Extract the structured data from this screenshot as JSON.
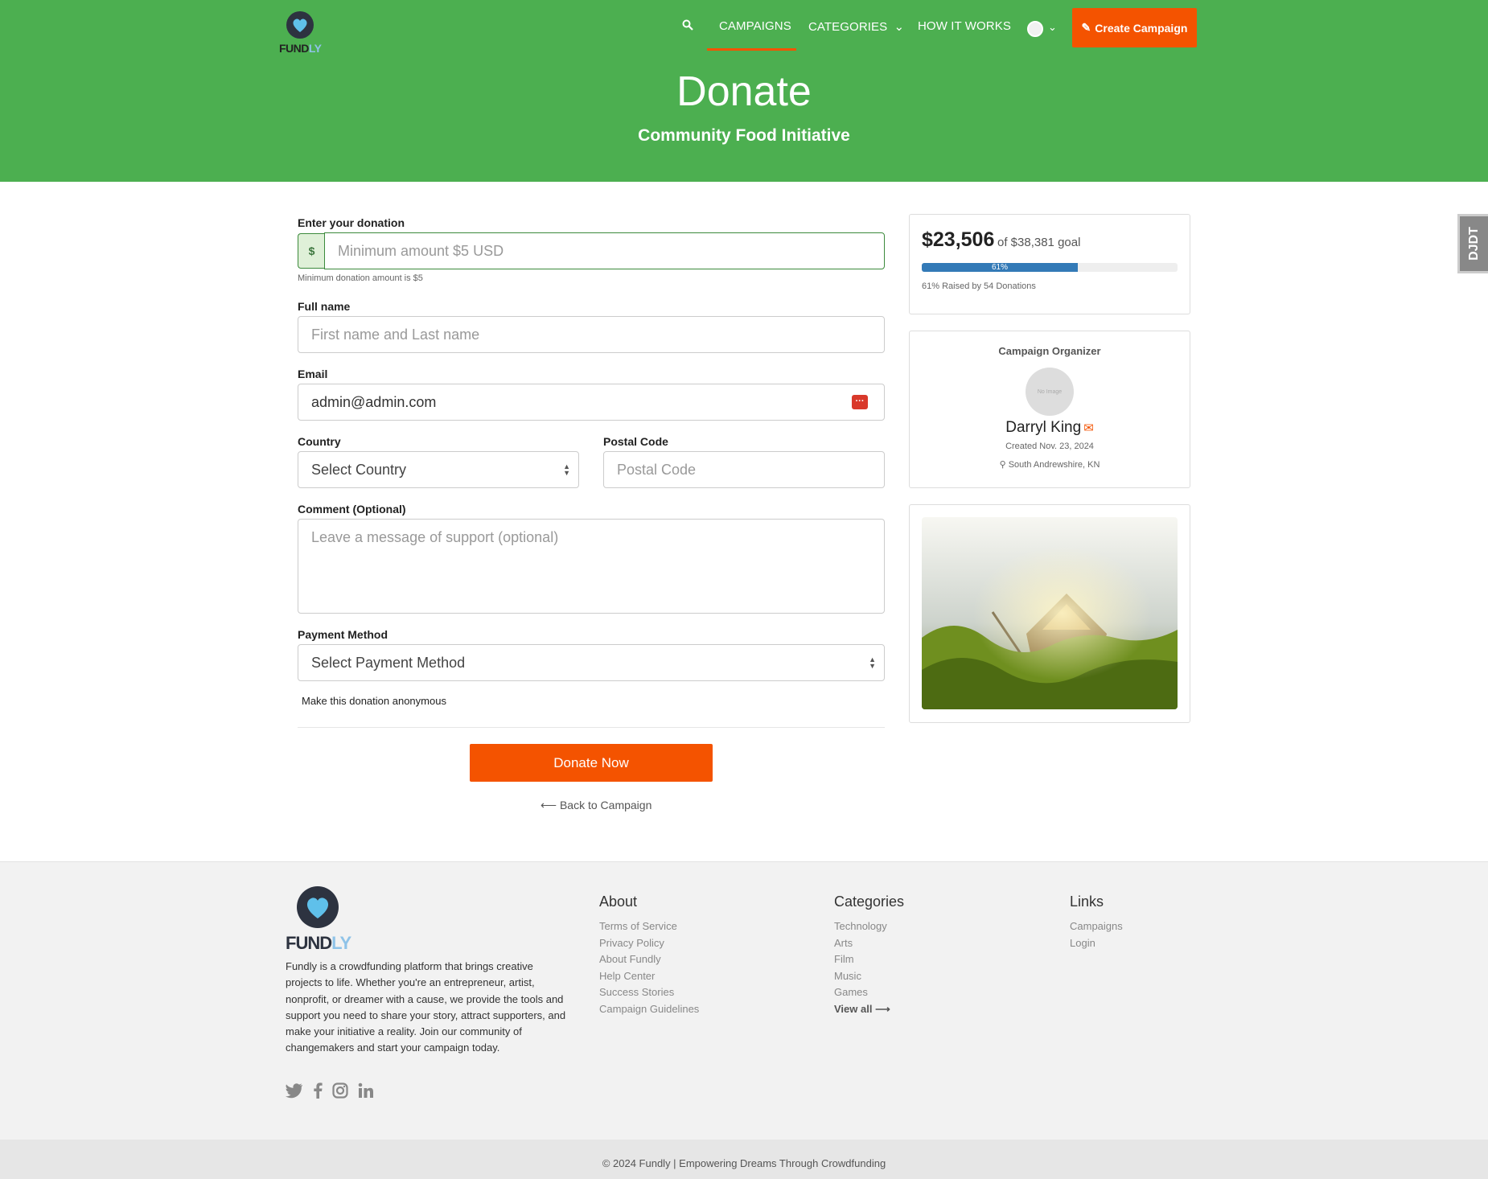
{
  "header": {
    "logo_word": "FUND",
    "logo_word_accent": "LY",
    "nav": {
      "search_icon": "search-icon",
      "campaigns": "CAMPAIGNS",
      "categories": "CATEGORIES",
      "how_it_works": "HOW IT WORKS",
      "create_campaign": "Create Campaign"
    },
    "title": "Donate",
    "subtitle": "Community Food Initiative",
    "accent_color": "#4caf50",
    "cta_color": "#f45300"
  },
  "form": {
    "donation": {
      "label": "Enter your donation",
      "currency": "$",
      "placeholder": "Minimum amount $5 USD",
      "hint": "Minimum donation amount is $5"
    },
    "full_name": {
      "label": "Full name",
      "placeholder": "First name and Last name"
    },
    "email": {
      "label": "Email",
      "value": "admin@admin.com"
    },
    "country": {
      "label": "Country",
      "selected": "Select Country"
    },
    "postal": {
      "label": "Postal Code",
      "placeholder": "Postal Code"
    },
    "comment": {
      "label": "Comment (Optional)",
      "placeholder": "Leave a message of support (optional)"
    },
    "payment": {
      "label": "Payment Method",
      "selected": "Select Payment Method"
    },
    "anonymous_label": "Make this donation anonymous",
    "submit_label": "Donate Now",
    "back_label": "Back to Campaign"
  },
  "campaign": {
    "raised": "$23,506",
    "goal_text": "of $38,381 goal",
    "percent": 61,
    "percent_label": "61%",
    "stats": "61% Raised by 54 Donations"
  },
  "organizer": {
    "heading": "Campaign Organizer",
    "avatar_text": "No Image",
    "name": "Darryl King",
    "created": "Created Nov. 23, 2024",
    "location": "South Andrewshire, KN"
  },
  "side_tab": "DJDT",
  "footer": {
    "logo_word": "FUND",
    "logo_word_accent": "LY",
    "description": "Fundly is a crowdfunding platform that brings creative projects to life. Whether you're an entrepreneur, artist, nonprofit, or dreamer with a cause, we provide the tools and support you need to share your story, attract supporters, and make your initiative a reality. Join our community of changemakers and start your campaign today.",
    "about": {
      "heading": "About",
      "items": [
        "Terms of Service",
        "Privacy Policy",
        "About Fundly",
        "Help Center",
        "Success Stories",
        "Campaign Guidelines"
      ]
    },
    "categories": {
      "heading": "Categories",
      "items": [
        "Technology",
        "Arts",
        "Film",
        "Music",
        "Games"
      ],
      "view_all": "View all"
    },
    "links": {
      "heading": "Links",
      "items": [
        "Campaigns",
        "Login"
      ]
    },
    "copyright": "© 2024 Fundly | Empowering Dreams Through Crowdfunding"
  }
}
